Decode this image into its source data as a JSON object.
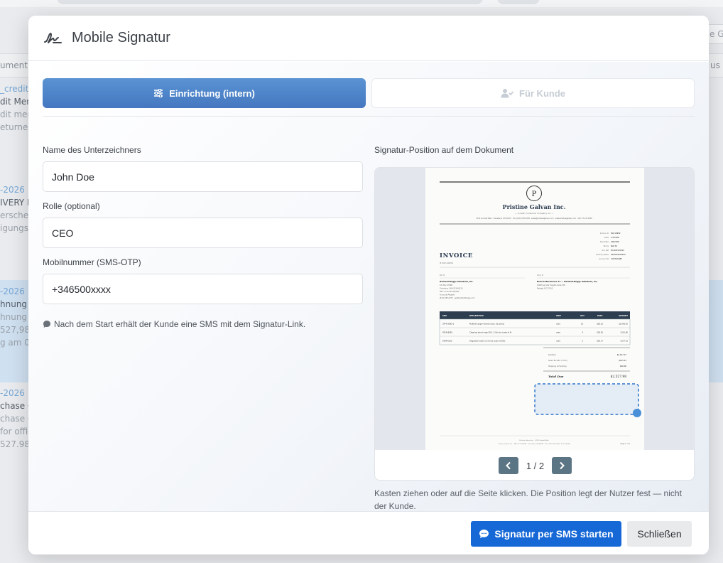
{
  "background": {
    "columns": [
      "ument",
      "us"
    ],
    "search_fragment": "e G",
    "items": [
      {
        "lines": [
          "_credit",
          "dit Men",
          "dit men",
          "eturnec"
        ]
      },
      {
        "lines": [
          "-2026",
          "IVERY N",
          "erschei",
          "igungs("
        ]
      },
      {
        "lines": [
          "-2026",
          "hnung :",
          "hnung v",
          "527,98 f",
          "g am 0("
        ]
      },
      {
        "lines": [
          "-2026",
          "chase C",
          "chase o",
          "for offic",
          "527.98."
        ]
      }
    ]
  },
  "modal": {
    "title": "Mobile Signatur",
    "tabs": [
      {
        "label": "Einrichtung (intern)",
        "active": true,
        "icon": "sliders-icon"
      },
      {
        "label": "Für Kunde",
        "active": false,
        "icon": "user-check-icon"
      }
    ],
    "fields": {
      "signer_name": {
        "label": "Name des Unterzeichners",
        "value": "John Doe"
      },
      "role": {
        "label": "Rolle (optional)",
        "value": "CEO"
      },
      "mobile": {
        "label": "Mobilnummer (SMS-OTP)",
        "value": "+346500xxxx"
      }
    },
    "hint": "Nach dem Start erhält der Kunde eine SMS mit dem Signatur-Link.",
    "position": {
      "label": "Signatur-Position auf dem Dokument",
      "page_indicator": "1 / 2",
      "note": "Kasten ziehen oder auf die Seite klicken. Die Position legt der Nutzer fest — nicht der Kunde."
    },
    "invoice": {
      "logo_letter": "P",
      "company": "Pristine Galvan Inc.",
      "tagline": "— a clean consumer company inc —",
      "contact_line": "4741 Grindal Walk · Cleveland, OH 44147 · Tel: (216) 555-0184 · sales@pristinegalvan.com · www.pristinegalvan.com · VAT: 47-1271836",
      "doc_title": "INVOICE",
      "doc_number": "# INV-10952",
      "meta": [
        [
          "Invoice #",
          "INV-10952"
        ],
        [
          "Date",
          "1/7/2026"
        ],
        [
          "Due Date",
          "2/6/2026"
        ],
        [
          "Terms",
          "Net 30"
        ],
        [
          "Our Ref",
          "PO-2025-0912"
        ],
        [
          "Delivery Note",
          "DN-2026-00014"
        ],
        [
          "Account #",
          "CUST-00487"
        ]
      ],
      "bill_to_label": "Bill To",
      "bill_to": [
        "Hartwell-Briggs Industries, Inc.",
        "P.O. Box 47988",
        "Columbus, OH 43218-8110",
        "Attn: Accounts Payable",
        "Accounts Payable",
        "(614) 555-0273 · ap@hartwellbriggs.com"
      ],
      "ship_to_label": "Ship To",
      "ship_to": [
        "Branch Warehouse #7 — Hartwell-Briggs Industries, Inc.",
        "10695 Jennifer Heights Suite 978",
        "Raleigh, NC 27615"
      ],
      "table_headers": [
        "SKU",
        "DESCRIPTION",
        "UNIT",
        "QTY",
        "RATE",
        "AMOUNT"
      ],
      "rows": [
        [
          "OFFR-3892-0",
          "Multifold paper towels (case, 16 packs)",
          "case",
          "30",
          "$83.10",
          "$2,493.00"
        ],
        [
          "FRCN-8285",
          "Cleaning bench rags 50%, 12-lb box (case of 4)",
          "case",
          "4",
          "$28.95",
          "$115.80"
        ],
        [
          "SWIP-8320",
          "Degreaser trash can liners (case of 500)",
          "case",
          "3",
          "$59.17",
          "$177.51"
        ]
      ],
      "totals": [
        [
          "Subtotal",
          "$2,417.17"
        ],
        [
          "Sales Tax (NC 7.25%)",
          "$155.21"
        ],
        [
          "Shipping & Handling",
          "$46.00"
        ]
      ],
      "total_due_label": "Total Due",
      "total_due_value": "$2,527.98",
      "footer_lines": [
        "Pristine Galvan Inc. · 4741 Grindal Walk",
        "Pristine Galvan Inc. · VAT: 47-1271836 · Cleveland, OH 44147 · Tel: (216) 555-0184 · 47-1271836"
      ],
      "page_label": "Page 1 of 2"
    }
  },
  "footer": {
    "primary_label": "Signatur per SMS starten",
    "secondary_label": "Schließen"
  }
}
